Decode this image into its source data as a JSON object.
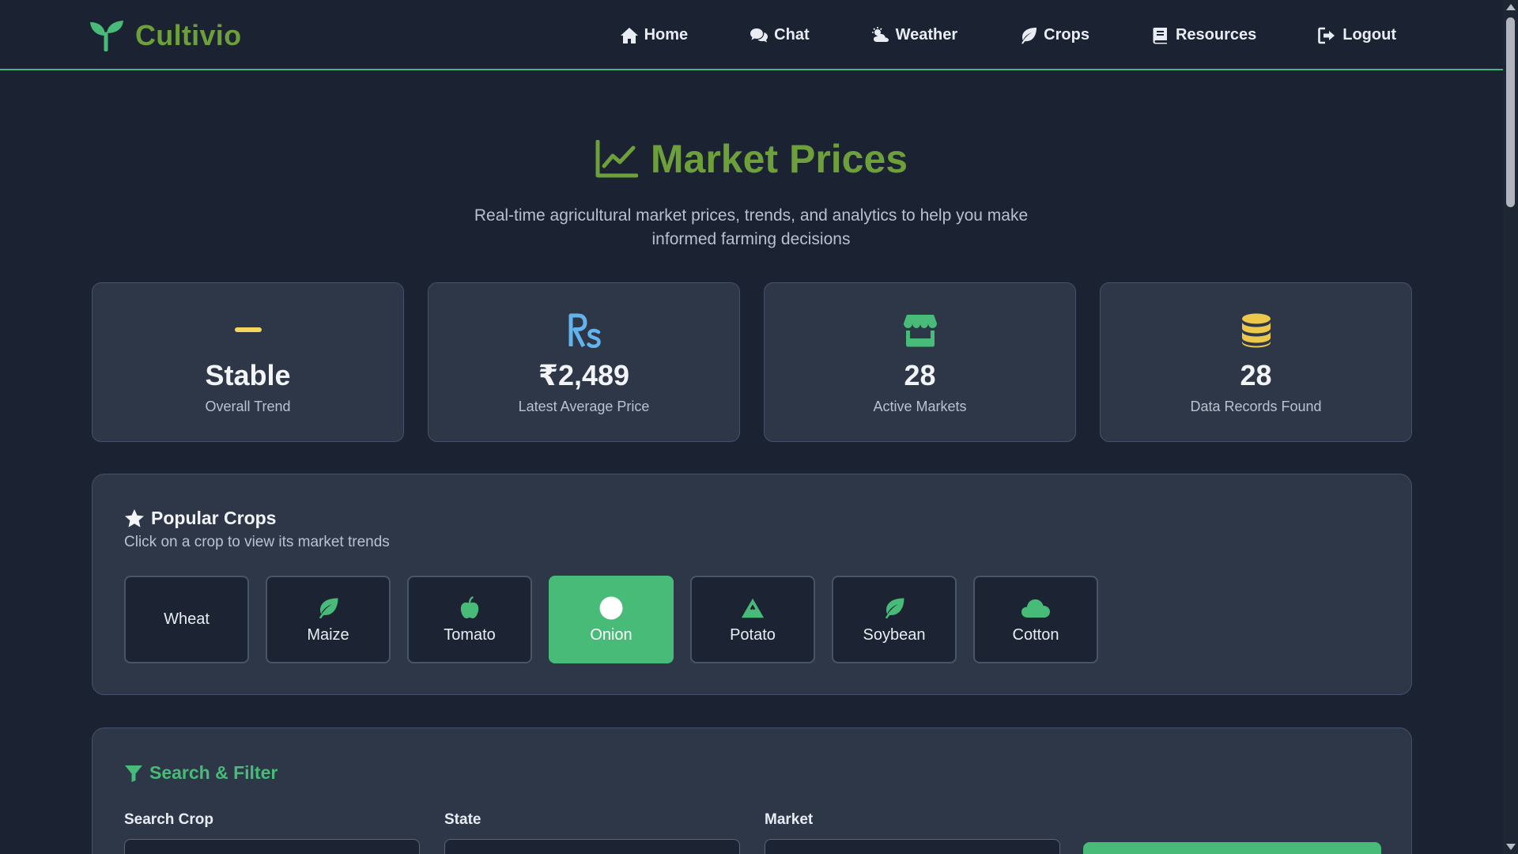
{
  "brand": {
    "name": "Cultivio"
  },
  "nav": {
    "items": [
      {
        "label": "Home",
        "icon": "home-icon"
      },
      {
        "label": "Chat",
        "icon": "chat-icon"
      },
      {
        "label": "Weather",
        "icon": "weather-icon"
      },
      {
        "label": "Crops",
        "icon": "leaf-icon"
      },
      {
        "label": "Resources",
        "icon": "book-icon"
      },
      {
        "label": "Logout",
        "icon": "logout-icon"
      }
    ]
  },
  "hero": {
    "title": "Market Prices",
    "subtitle": "Real-time agricultural market prices, trends, and analytics to help you make informed farming decisions"
  },
  "stats": [
    {
      "value": "Stable",
      "label": "Overall Trend",
      "icon": "minus-icon",
      "color": "#f6d55c"
    },
    {
      "value": "₹2,489",
      "label": "Latest Average Price",
      "icon": "rupee-icon",
      "color": "#63b3ed"
    },
    {
      "value": "28",
      "label": "Active Markets",
      "icon": "store-icon",
      "color": "#48bb78"
    },
    {
      "value": "28",
      "label": "Data Records Found",
      "icon": "database-icon",
      "color": "#ecc94b"
    }
  ],
  "popular_crops": {
    "title": "Popular Crops",
    "subtitle": "Click on a crop to view its market trends",
    "items": [
      {
        "label": "Wheat",
        "icon": "",
        "active": false
      },
      {
        "label": "Maize",
        "icon": "leaf-icon",
        "active": false
      },
      {
        "label": "Tomato",
        "icon": "apple-icon",
        "active": false
      },
      {
        "label": "Onion",
        "icon": "circle-icon",
        "active": true
      },
      {
        "label": "Potato",
        "icon": "mountain-icon",
        "active": false
      },
      {
        "label": "Soybean",
        "icon": "leaf-icon",
        "active": false
      },
      {
        "label": "Cotton",
        "icon": "cloud-icon",
        "active": false
      }
    ]
  },
  "search": {
    "title": "Search & Filter",
    "fields": [
      {
        "label": "Search Crop",
        "value": ""
      },
      {
        "label": "State",
        "value": ""
      },
      {
        "label": "Market",
        "value": ""
      }
    ]
  },
  "colors": {
    "accent": "#48bb78",
    "brand": "#6d9f3a",
    "background": "#1b2332",
    "card": "#2d3748"
  }
}
